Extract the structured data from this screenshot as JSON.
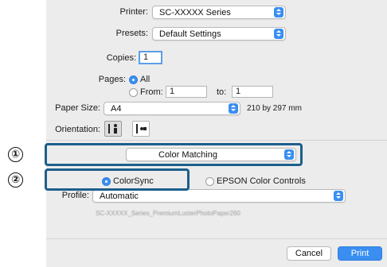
{
  "dialog": {
    "printer_label": "Printer:",
    "printer_value": "SC-XXXXX Series",
    "presets_label": "Presets:",
    "presets_value": "Default Settings",
    "copies_label": "Copies:",
    "copies_value": "1",
    "pages_label": "Pages:",
    "pages_all": "All",
    "pages_from": "From:",
    "from_value": "1",
    "pages_to": "to:",
    "to_value": "1",
    "paper_size_label": "Paper Size:",
    "paper_size_value": "A4",
    "paper_size_dims": "210 by 297 mm",
    "orientation_label": "Orientation:",
    "section_value": "Color Matching",
    "colorsync_label": "ColorSync",
    "epson_label": "EPSON Color Controls",
    "profile_label": "Profile:",
    "profile_value": "Automatic",
    "profile_detail": "SC-XXXXX_Series_PremiumLusterPhotoPaper260",
    "cancel_label": "Cancel",
    "print_label": "Print"
  },
  "callouts": {
    "one": "①",
    "two": "②"
  },
  "colors": {
    "accent": "#3a8ef2",
    "callout_border": "#1d5f8c",
    "panel_bg": "#ececec"
  }
}
